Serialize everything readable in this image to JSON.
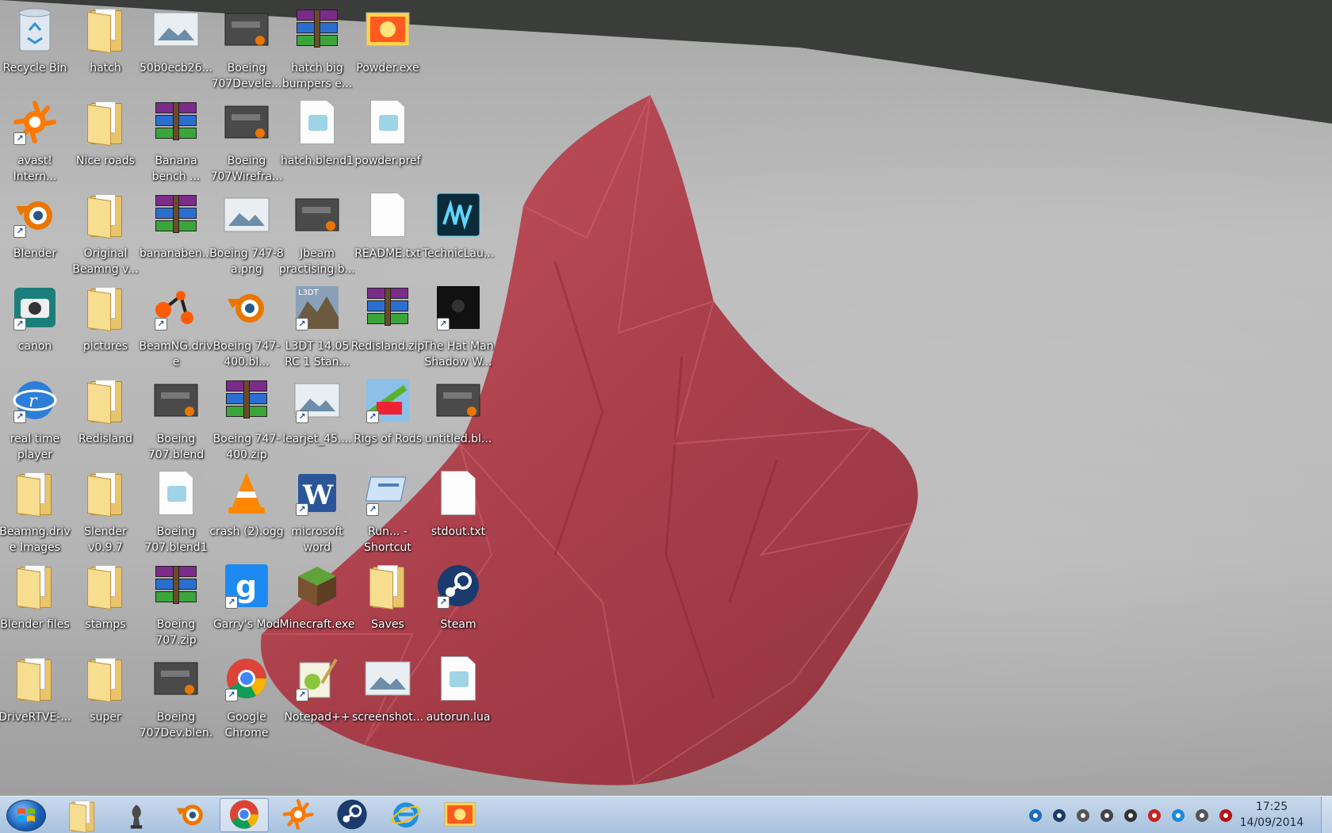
{
  "desktop": {
    "icons": [
      {
        "label": "Recycle Bin",
        "icon": "recycle-bin-icon",
        "col": 0,
        "row": 0,
        "shortcut": false
      },
      {
        "label": "hatch",
        "icon": "folder-icon",
        "col": 1,
        "row": 0,
        "shortcut": false
      },
      {
        "label": "50b0ecb26...",
        "icon": "image-icon",
        "col": 2,
        "row": 0,
        "shortcut": false
      },
      {
        "label": "Boeing 707Devele...",
        "icon": "blend-file-icon",
        "col": 3,
        "row": 0,
        "shortcut": false
      },
      {
        "label": "hatch big bumpers e...",
        "icon": "archive-icon",
        "col": 4,
        "row": 0,
        "shortcut": false
      },
      {
        "label": "Powder.exe",
        "icon": "powder-app-icon",
        "col": 5,
        "row": 0,
        "shortcut": false
      },
      {
        "label": "avast! Intern...",
        "icon": "avast-icon",
        "col": 0,
        "row": 1,
        "shortcut": true
      },
      {
        "label": "Nice roads",
        "icon": "folder-icon",
        "col": 1,
        "row": 1,
        "shortcut": false
      },
      {
        "label": "Banana bench ...",
        "icon": "archive-icon",
        "col": 2,
        "row": 1,
        "shortcut": false
      },
      {
        "label": "Boeing 707Wirefra...",
        "icon": "blend-file-icon",
        "col": 3,
        "row": 1,
        "shortcut": false
      },
      {
        "label": "hatch.blend1",
        "icon": "document-icon",
        "col": 4,
        "row": 1,
        "shortcut": false
      },
      {
        "label": "powder.pref",
        "icon": "document-icon",
        "col": 5,
        "row": 1,
        "shortcut": false
      },
      {
        "label": "Blender",
        "icon": "blender-icon",
        "col": 0,
        "row": 2,
        "shortcut": true
      },
      {
        "label": "Original Beamng v...",
        "icon": "folder-icon",
        "col": 1,
        "row": 2,
        "shortcut": false
      },
      {
        "label": "bananaben...",
        "icon": "archive-icon",
        "col": 2,
        "row": 2,
        "shortcut": false
      },
      {
        "label": "Boeing 747-8 a.png",
        "icon": "image-icon",
        "col": 3,
        "row": 2,
        "shortcut": false
      },
      {
        "label": "Jbeam practising.b...",
        "icon": "blend-file-icon",
        "col": 4,
        "row": 2,
        "shortcut": false
      },
      {
        "label": "README.txt",
        "icon": "text-file-icon",
        "col": 5,
        "row": 2,
        "shortcut": false
      },
      {
        "label": "TechnicLau...",
        "icon": "technic-launcher-icon",
        "col": 6,
        "row": 2,
        "shortcut": false
      },
      {
        "label": "canon",
        "icon": "camera-icon",
        "col": 0,
        "row": 3,
        "shortcut": true
      },
      {
        "label": "pictures",
        "icon": "folder-icon",
        "col": 1,
        "row": 3,
        "shortcut": false
      },
      {
        "label": "BeamNG.drive",
        "icon": "beamng-icon",
        "col": 2,
        "row": 3,
        "shortcut": true
      },
      {
        "label": "Boeing 747-400.bl...",
        "icon": "blender-icon",
        "col": 3,
        "row": 3,
        "shortcut": false
      },
      {
        "label": "L3DT 14.05 RC 1 Stan...",
        "icon": "l3dt-icon",
        "col": 4,
        "row": 3,
        "shortcut": true
      },
      {
        "label": "Redisland.zip",
        "icon": "archive-icon",
        "col": 5,
        "row": 3,
        "shortcut": false
      },
      {
        "label": "The Hat Man Shadow W...",
        "icon": "game-icon",
        "col": 6,
        "row": 3,
        "shortcut": true
      },
      {
        "label": "real time player",
        "icon": "realplayer-icon",
        "col": 0,
        "row": 4,
        "shortcut": true
      },
      {
        "label": "Redisland",
        "icon": "folder-icon",
        "col": 1,
        "row": 4,
        "shortcut": false
      },
      {
        "label": "Boeing 707.blend",
        "icon": "blend-file-icon",
        "col": 2,
        "row": 4,
        "shortcut": false
      },
      {
        "label": "Boeing 747-400.zip",
        "icon": "archive-icon",
        "col": 3,
        "row": 4,
        "shortcut": false
      },
      {
        "label": "learjet_45....",
        "icon": "image-icon",
        "col": 4,
        "row": 4,
        "shortcut": true
      },
      {
        "label": "Rigs of Rods",
        "icon": "rigs-of-rods-icon",
        "col": 5,
        "row": 4,
        "shortcut": true
      },
      {
        "label": "untitled.bl...",
        "icon": "blend-file-icon",
        "col": 6,
        "row": 4,
        "shortcut": false
      },
      {
        "label": "Beamng.drive Images",
        "icon": "folder-icon",
        "col": 0,
        "row": 5,
        "shortcut": false
      },
      {
        "label": "Slender v0.9.7",
        "icon": "folder-icon",
        "col": 1,
        "row": 5,
        "shortcut": false
      },
      {
        "label": "Boeing 707.blend1",
        "icon": "document-icon",
        "col": 2,
        "row": 5,
        "shortcut": false
      },
      {
        "label": "crash (2).ogg",
        "icon": "vlc-icon",
        "col": 3,
        "row": 5,
        "shortcut": false
      },
      {
        "label": "microsoft word",
        "icon": "word-icon",
        "col": 4,
        "row": 5,
        "shortcut": true
      },
      {
        "label": "Run... - Shortcut",
        "icon": "run-icon",
        "col": 5,
        "row": 5,
        "shortcut": true
      },
      {
        "label": "stdout.txt",
        "icon": "text-file-icon",
        "col": 6,
        "row": 5,
        "shortcut": false
      },
      {
        "label": "Blender files",
        "icon": "folder-icon",
        "col": 0,
        "row": 6,
        "shortcut": false
      },
      {
        "label": "stamps",
        "icon": "folder-icon",
        "col": 1,
        "row": 6,
        "shortcut": false
      },
      {
        "label": "Boeing 707.zip",
        "icon": "archive-icon",
        "col": 2,
        "row": 6,
        "shortcut": false
      },
      {
        "label": "Garry's Mod",
        "icon": "garrys-mod-icon",
        "col": 3,
        "row": 6,
        "shortcut": true
      },
      {
        "label": "Minecraft.exe",
        "icon": "minecraft-icon",
        "col": 4,
        "row": 6,
        "shortcut": false
      },
      {
        "label": "Saves",
        "icon": "folder-icon",
        "col": 5,
        "row": 6,
        "shortcut": false
      },
      {
        "label": "Steam",
        "icon": "steam-icon",
        "col": 6,
        "row": 6,
        "shortcut": true
      },
      {
        "label": "DriveRTVE-...",
        "icon": "folder-icon",
        "col": 0,
        "row": 7,
        "shortcut": false
      },
      {
        "label": "super",
        "icon": "folder-icon",
        "col": 1,
        "row": 7,
        "shortcut": false
      },
      {
        "label": "Boeing 707Dev.blen...",
        "icon": "blend-file-icon",
        "col": 2,
        "row": 7,
        "shortcut": false
      },
      {
        "label": "Google Chrome",
        "icon": "chrome-icon",
        "col": 3,
        "row": 7,
        "shortcut": true
      },
      {
        "label": "Notepad++",
        "icon": "notepad-plus-plus-icon",
        "col": 4,
        "row": 7,
        "shortcut": true
      },
      {
        "label": "screenshot...",
        "icon": "image-icon",
        "col": 5,
        "row": 7,
        "shortcut": false
      },
      {
        "label": "autorun.lua",
        "icon": "document-icon",
        "col": 6,
        "row": 7,
        "shortcut": false
      }
    ]
  },
  "taskbar": {
    "start_icon": "windows-start-icon",
    "apps": [
      {
        "name": "explorer",
        "icon": "folder-explorer-icon",
        "active": false
      },
      {
        "name": "chess",
        "icon": "chess-icon",
        "active": false
      },
      {
        "name": "blender",
        "icon": "blender-icon",
        "active": false
      },
      {
        "name": "chrome",
        "icon": "chrome-icon",
        "active": true
      },
      {
        "name": "avast",
        "icon": "avast-icon",
        "active": false
      },
      {
        "name": "steam",
        "icon": "steam-icon",
        "active": false
      },
      {
        "name": "internet-explorer",
        "icon": "internet-explorer-icon",
        "active": false
      },
      {
        "name": "powder",
        "icon": "powder-app-icon",
        "active": false
      }
    ],
    "tray": [
      "network-status-icon",
      "steam-tray-icon",
      "volume-icon",
      "action-center-flag-icon",
      "app-tray-icon",
      "avast-tray-icon",
      "skype-tray-icon",
      "signal-icon",
      "security-tray-icon"
    ],
    "clock": {
      "time": "17:25",
      "date": "14/09/2014"
    }
  },
  "colors": {
    "wall": "#3b3d3a",
    "floor": "#b5b5b5",
    "mountain": "#b43a46",
    "taskbar": "#b8cde4"
  }
}
